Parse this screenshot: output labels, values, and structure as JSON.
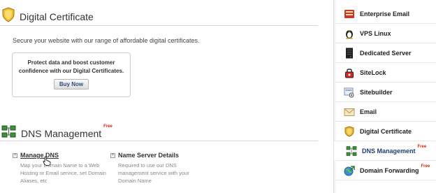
{
  "digital_certificate": {
    "title": "Digital Certificate",
    "intro": "Secure your website with our range of affordable digital certificates.",
    "promo_text": "Protect data and boost customer confidence with our Digital Certificates.",
    "buy_label": "Buy Now"
  },
  "dns_management": {
    "title": "DNS Management",
    "free_badge": "Free",
    "items": [
      {
        "label": "Manage DNS",
        "description": "Map your Domain Name to a Web Hosting or Email service, set Domain Aliases, etc"
      },
      {
        "label": "Name Server Details",
        "description": "Required to use our DNS management service with your Domain Name"
      }
    ]
  },
  "sidebar": {
    "items": [
      {
        "label": "Enterprise Email",
        "icon": "enterprise-email-icon"
      },
      {
        "label": "VPS Linux",
        "icon": "linux-penguin-icon"
      },
      {
        "label": "Dedicated Server",
        "icon": "server-icon"
      },
      {
        "label": "SiteLock",
        "icon": "sitelock-icon"
      },
      {
        "label": "Sitebuilder",
        "icon": "sitebuilder-icon"
      },
      {
        "label": "Email",
        "icon": "email-envelope-icon"
      },
      {
        "label": "Digital Certificate",
        "icon": "certificate-shield-icon"
      },
      {
        "label": "DNS Management",
        "icon": "dns-network-icon",
        "free": "Free",
        "active": true
      },
      {
        "label": "Domain Forwarding",
        "icon": "domain-forwarding-icon",
        "free": "Free"
      }
    ]
  },
  "colors": {
    "free_badge": "#cc2200",
    "active_link": "#1f3c74",
    "button_text": "#2a4a7a"
  }
}
